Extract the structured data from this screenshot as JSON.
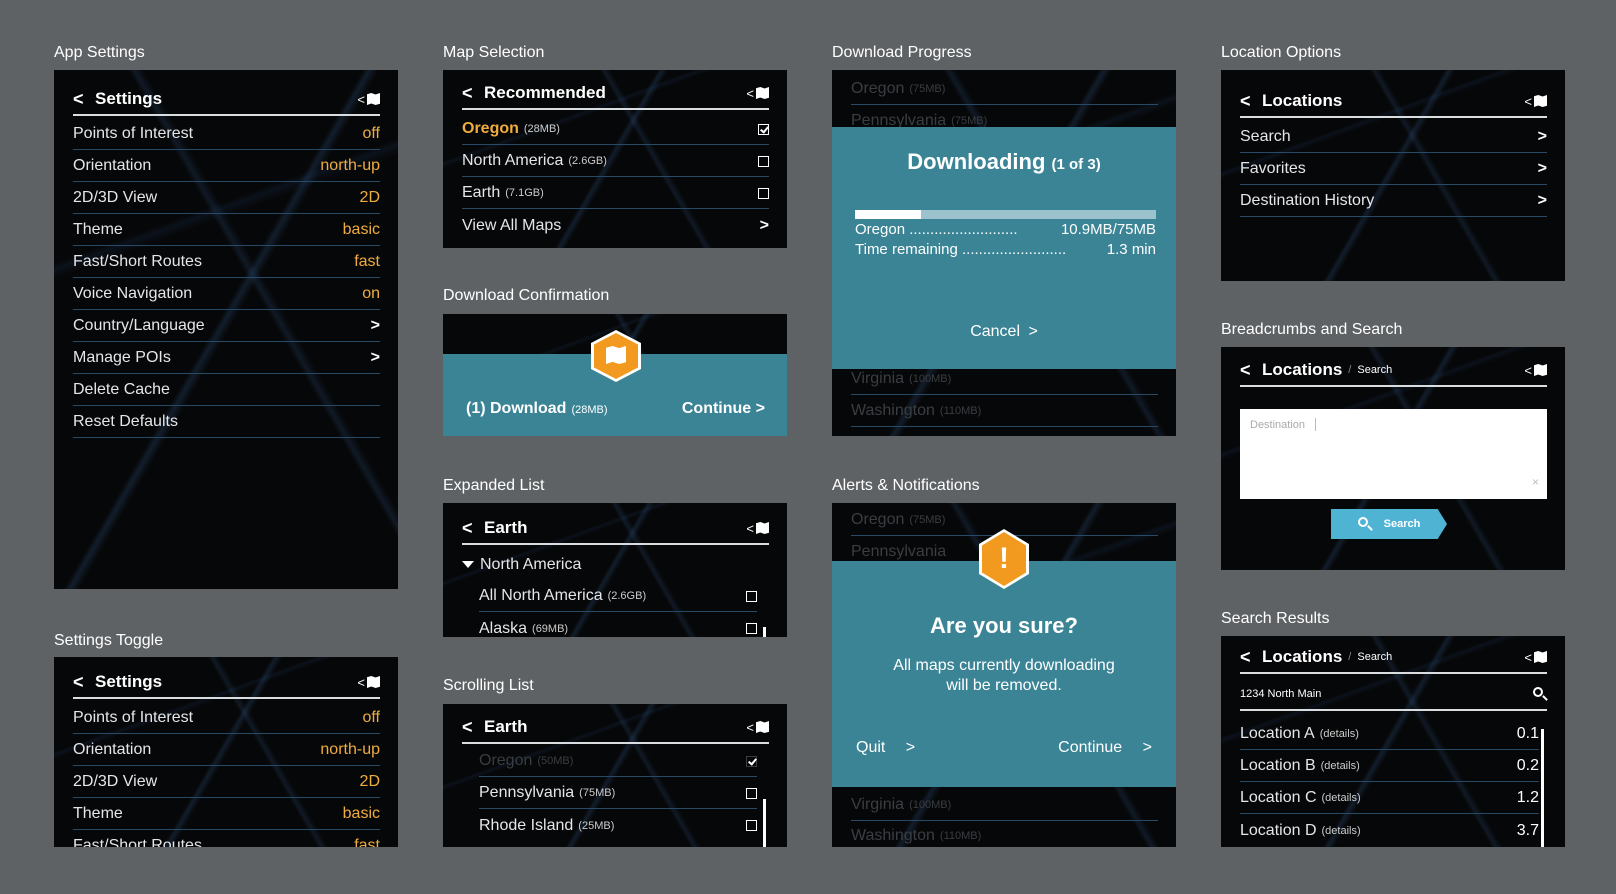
{
  "captions": {
    "app_settings": "App Settings",
    "settings_toggle": "Settings Toggle",
    "map_selection": "Map Selection",
    "download_confirmation": "Download Confirmation",
    "expanded_list": "Expanded List",
    "scrolling_list": "Scrolling List",
    "download_progress": "Download Progress",
    "alerts": "Alerts & Notifications",
    "location_options": "Location Options",
    "breadcrumbs": "Breadcrumbs and Search",
    "search_results": "Search Results"
  },
  "back_glyph": "<",
  "settings": {
    "title": "Settings",
    "items": [
      {
        "label": "Points of Interest",
        "value": "off"
      },
      {
        "label": "Orientation",
        "value": "north-up"
      },
      {
        "label": "2D/3D View",
        "value": "2D"
      },
      {
        "label": "Theme",
        "value": "basic"
      },
      {
        "label": "Fast/Short Routes",
        "value": "fast"
      },
      {
        "label": "Voice Navigation",
        "value": "on"
      },
      {
        "label": "Country/Language",
        "value": ""
      },
      {
        "label": "Manage POIs",
        "value": ""
      },
      {
        "label": "Delete Cache",
        "value": ""
      },
      {
        "label": "Reset Defaults",
        "value": ""
      }
    ],
    "partial_last": {
      "label": "Fast/Short Routes",
      "value": "fast"
    }
  },
  "map_selection": {
    "title": "Recommended",
    "items": [
      {
        "label": "Oregon",
        "size": "(28MB)"
      },
      {
        "label": "North America",
        "size": "(2.6GB)"
      },
      {
        "label": "Earth",
        "size": "(7.1GB)"
      },
      {
        "label": "View All Maps",
        "size": ""
      }
    ]
  },
  "confirmation": {
    "download_label": "(1) Download",
    "size": "(28MB)",
    "continue": "Continue"
  },
  "expanded": {
    "title": "Earth",
    "group": "North America",
    "items": [
      {
        "label": "All North America",
        "size": "(2.6GB)"
      },
      {
        "label": "Alaska",
        "size": "(69MB)"
      }
    ]
  },
  "scrolling": {
    "title": "Earth",
    "items": [
      {
        "label": "Oregon",
        "size": "(50MB)"
      },
      {
        "label": "Pennsylvania",
        "size": "(75MB)"
      },
      {
        "label": "Rhode Island",
        "size": "(25MB)"
      }
    ]
  },
  "progress": {
    "bg_items": [
      {
        "label": "Oregon",
        "size": "(75MB)"
      },
      {
        "label": "Pennsylvania",
        "size": "(75MB)"
      },
      {
        "label": "Virginia",
        "size": "(100MB)"
      },
      {
        "label": "Washington",
        "size": "(110MB)"
      }
    ],
    "heading": "Downloading",
    "count": "(1 of 3)",
    "fraction": 0.22,
    "line1_label": "Oregon ..........................",
    "line1_value": "10.9MB/75MB",
    "line2_label": "Time remaining .........................",
    "line2_value": "1.3 min",
    "cancel": "Cancel"
  },
  "alert": {
    "bg_items": [
      {
        "label": "Oregon",
        "size": "(75MB)"
      },
      {
        "label": "Pennsylvania",
        "size": ""
      },
      {
        "label": "Virginia",
        "size": "(100MB)"
      },
      {
        "label": "Washington",
        "size": "(110MB)"
      }
    ],
    "icon_glyph": "!",
    "heading": "Are you sure?",
    "message_line1": "All maps currently downloading",
    "message_line2": "will be removed.",
    "quit": "Quit",
    "continue": "Continue"
  },
  "locations": {
    "title": "Locations",
    "items": [
      "Search",
      "Favorites",
      "Destination History"
    ]
  },
  "breadcrumb_search": {
    "title": "Locations",
    "sep": "/",
    "crumb": "Search",
    "placeholder": "Destination",
    "clear": "×",
    "button": "Search"
  },
  "search_results": {
    "title": "Locations",
    "sep": "/",
    "crumb": "Search",
    "query": "1234 North Main",
    "results": [
      {
        "label": "Location A",
        "detail": "(details)",
        "distance": "0.1"
      },
      {
        "label": "Location B",
        "detail": "(details)",
        "distance": "0.2"
      },
      {
        "label": "Location C",
        "detail": "(details)",
        "distance": "1.2"
      },
      {
        "label": "Location D",
        "detail": "(details)",
        "distance": "3.7"
      }
    ]
  },
  "colors": {
    "accent": "#f0ad3f",
    "teal": "#3a8496",
    "search_button": "#4fb3d3"
  }
}
